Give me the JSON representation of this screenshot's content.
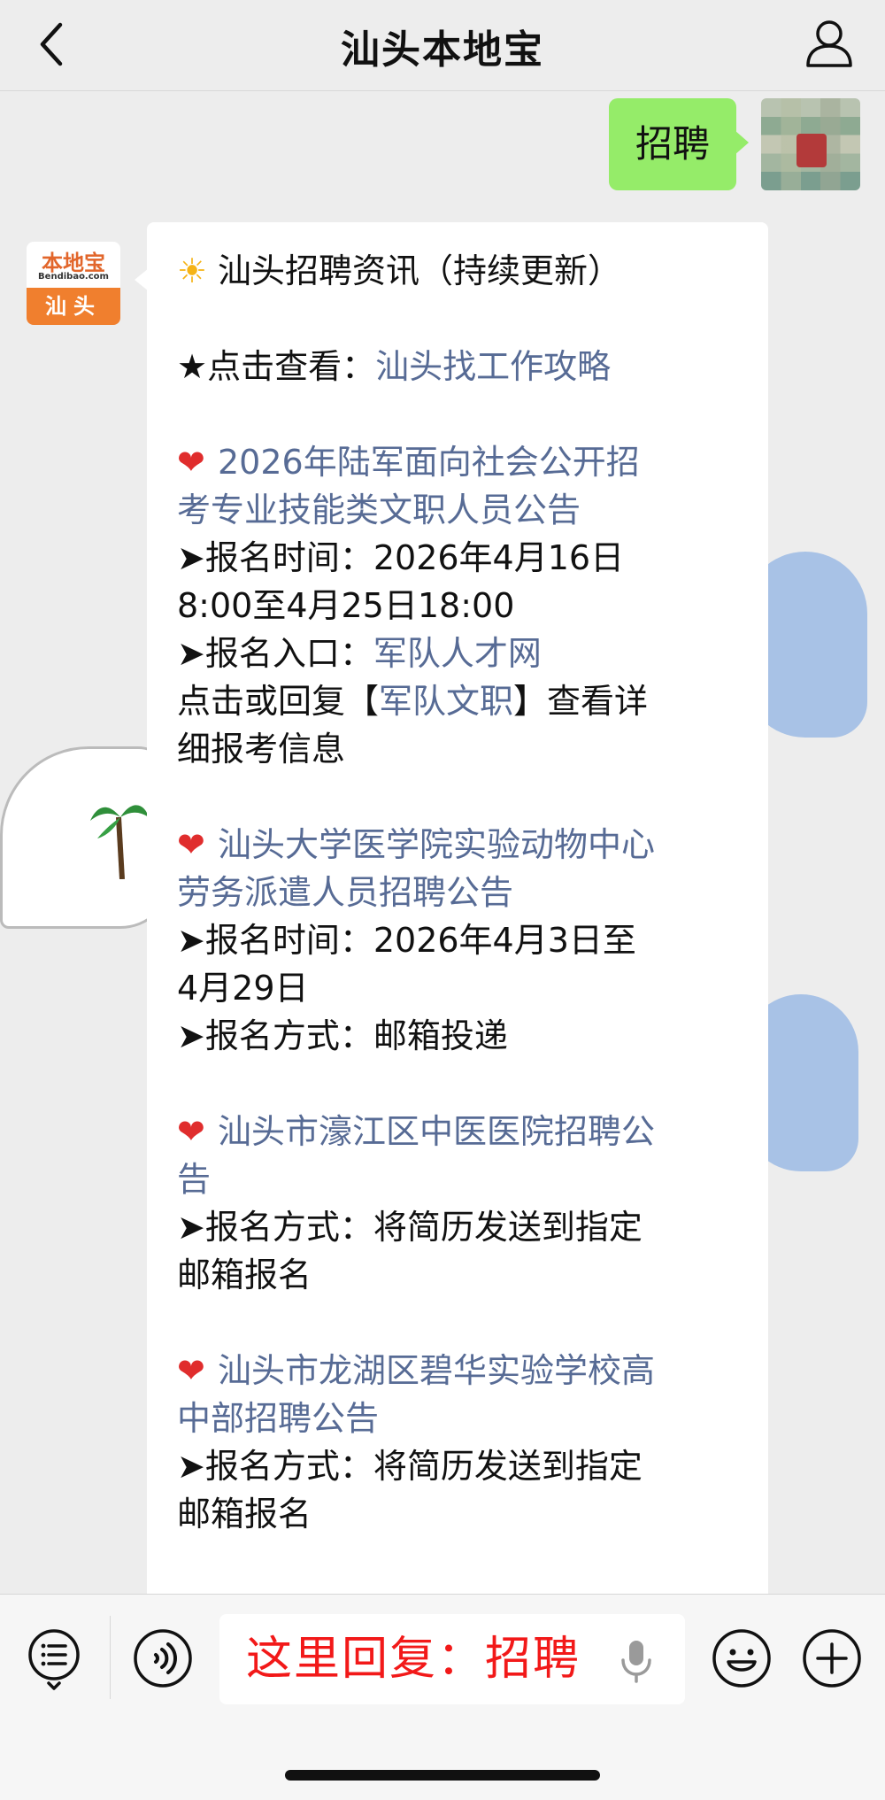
{
  "header": {
    "title": "汕头本地宝"
  },
  "icons": {
    "back": "back-chevron-icon",
    "profile": "person-icon",
    "menu": "menu-list-icon",
    "voice": "voice-input-icon",
    "mic": "microphone-icon",
    "emoji": "emoji-icon",
    "plus": "plus-icon"
  },
  "outgoing": {
    "text": "招聘"
  },
  "bot": {
    "brand": "本地宝",
    "brand_sub": "Bendibao.com",
    "city": "汕头"
  },
  "message": {
    "headline": "汕头招聘资讯（持续更新）",
    "guide_prefix": "★点击查看：",
    "guide_link": "汕头找工作攻略",
    "items": [
      {
        "title_line1": "2026年陆军面向社会公开招",
        "title_line2": "考专业技能类文职人员公告",
        "line1": "➤报名时间：2026年4月16日",
        "line2": "8:00至4月25日18:00",
        "entry_prefix": "➤报名入口：",
        "entry_link": "军队人才网",
        "reply_prefix": "点击或回复【",
        "reply_link": "军队文职",
        "reply_suffix": "】查看详",
        "reply_line2": "细报考信息"
      },
      {
        "title_line1": "汕头大学医学院实验动物中心",
        "title_line2": "劳务派遣人员招聘公告",
        "line1": "➤报名时间：2026年4月3日至",
        "line2": "4月29日",
        "line3": "➤报名方式：邮箱投递"
      },
      {
        "title_line1": "汕头市濠江区中医医院招聘公",
        "title_line2": "告",
        "line1": "➤报名方式：将简历发送到指定",
        "line2": "邮箱报名"
      },
      {
        "title_line1": "汕头市龙湖区碧华实验学校高",
        "title_line2": "中部招聘公告",
        "line1": "➤报名方式：将简历发送到指定",
        "line2": "邮箱报名"
      }
    ]
  },
  "input": {
    "text": "这里回复：招聘"
  },
  "colors": {
    "outgoing_bubble": "#95ec69",
    "link": "#576b95",
    "input_text": "#f21919",
    "background": "#ededed"
  }
}
